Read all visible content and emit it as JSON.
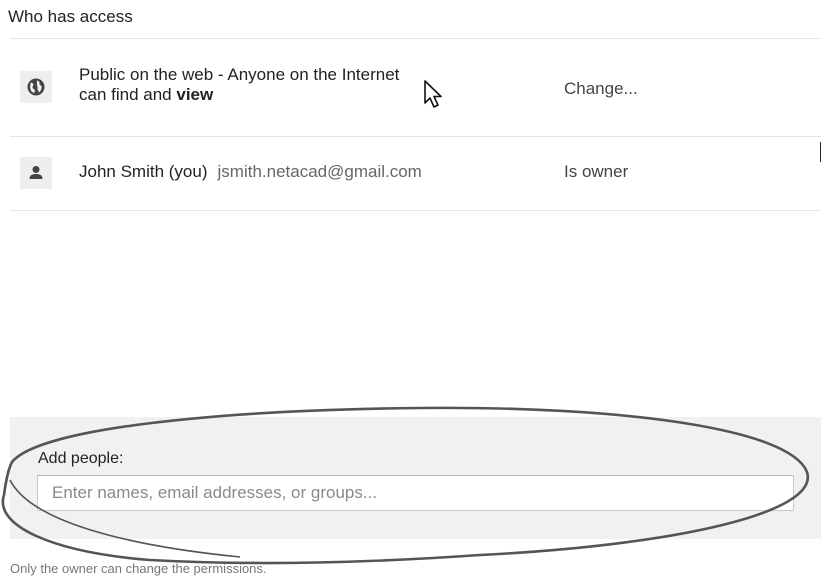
{
  "access": {
    "heading": "Who has access",
    "rows": [
      {
        "icon": "globe-icon",
        "line1": "Public on the web - Anyone on the Internet",
        "line2_prefix": "can find and ",
        "line2_bold": "view",
        "action": "Change..."
      },
      {
        "icon": "person-icon",
        "name": "John Smith (you)",
        "email": "jsmith.netacad@gmail.com",
        "action": "Is owner"
      }
    ]
  },
  "add_people": {
    "label": "Add people:",
    "placeholder": "Enter names, email addresses, or groups...",
    "value": ""
  },
  "footer": {
    "note": "Only the owner can change the permissions."
  },
  "colors": {
    "panel_bg": "#f1f1f1",
    "icon_bg": "#eeeeee",
    "annotation_stroke": "#555555"
  }
}
